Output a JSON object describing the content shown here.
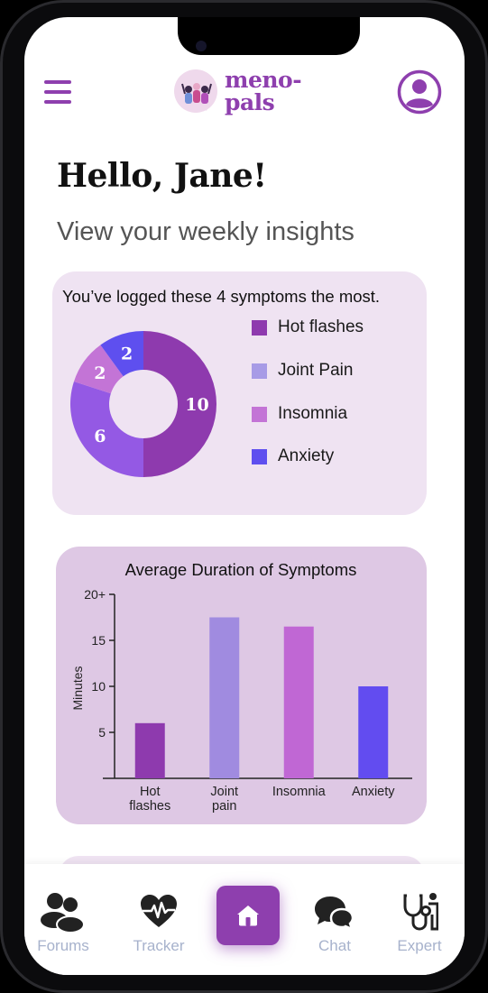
{
  "header": {
    "logo_line1": "meno-",
    "logo_line2": "pals",
    "menu_icon": "hamburger-menu-icon",
    "profile_icon": "user-profile-icon"
  },
  "greeting": "Hello, Jane!",
  "subtitle": "View your weekly insights",
  "colors": {
    "brand": "#8e3fae",
    "card_light": "#efe3f2",
    "card_dark": "#dec8e4",
    "nav_label": "#a7b2cc"
  },
  "symptoms_card": {
    "title": "You’ve logged these 4 symptoms the most.",
    "legend": [
      {
        "label": "Hot flashes",
        "color": "#8e3aae"
      },
      {
        "label": "Joint Pain",
        "color": "#a79be6"
      },
      {
        "label": "Insomnia",
        "color": "#c374d6"
      },
      {
        "label": "Anxiety",
        "color": "#5e4fef"
      }
    ]
  },
  "duration_card": {
    "title": "Average Duration of Symptoms"
  },
  "chart_data": [
    {
      "type": "pie",
      "title": "You’ve logged these 4 symptoms the most.",
      "categories": [
        "Hot flashes",
        "Joint Pain",
        "Insomnia",
        "Anxiety"
      ],
      "values": [
        10,
        6,
        2,
        2
      ],
      "slice_colors": [
        "#8e3aae",
        "#9459e4",
        "#c374d6",
        "#5e4fef"
      ],
      "legend": "right"
    },
    {
      "type": "bar",
      "title": "Average Duration of Symptoms",
      "categories": [
        "Hot\nflashes",
        "Joint\npain",
        "Insomnia",
        "Anxiety"
      ],
      "values": [
        6,
        17.5,
        16.5,
        10
      ],
      "colors": [
        "#8e3aae",
        "#a08be0",
        "#c067d4",
        "#624cf0"
      ],
      "ylabel": "Minutes",
      "xlabel": "",
      "ylim": [
        0,
        20
      ],
      "yticks": [
        "5",
        "10",
        "15",
        "20+"
      ],
      "ytick_values": [
        5,
        10,
        15,
        20
      ],
      "grid": false
    }
  ],
  "nav": {
    "items": [
      {
        "label": "Forums",
        "icon": "forums-people-icon"
      },
      {
        "label": "Tracker",
        "icon": "heartbeat-icon"
      },
      {
        "label": "Home",
        "icon": "home-icon"
      },
      {
        "label": "Chat",
        "icon": "chat-bubbles-icon"
      },
      {
        "label": "Expert",
        "icon": "stethoscope-icon"
      }
    ]
  }
}
